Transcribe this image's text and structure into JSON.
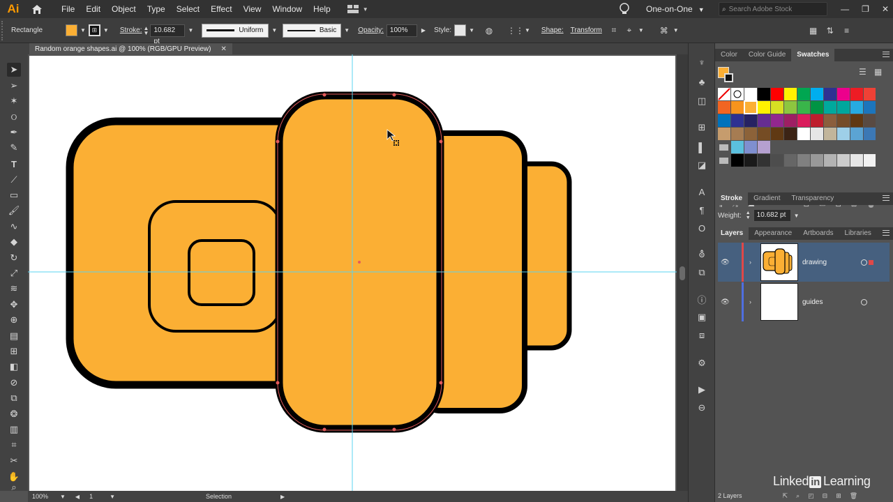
{
  "app": {
    "logo": "Ai"
  },
  "menu": [
    "File",
    "Edit",
    "Object",
    "Type",
    "Select",
    "Effect",
    "View",
    "Window",
    "Help"
  ],
  "workspace": "One-on-One",
  "search_placeholder": "Search Adobe Stock",
  "control_bar": {
    "selection_type": "Rectangle",
    "stroke_label": "Stroke:",
    "stroke_weight": "10.682 pt",
    "stroke_profile": "Uniform",
    "brush": "Basic",
    "opacity_label": "Opacity:",
    "opacity": "100%",
    "style_label": "Style:",
    "shape_label": "Shape:",
    "transform_label": "Transform"
  },
  "document_tab": {
    "title": "Random orange shapes.ai @ 100% (RGB/GPU Preview)"
  },
  "status_bar": {
    "zoom": "100%",
    "artboard": "1",
    "tool": "Selection"
  },
  "swatches_panel": {
    "tabs": [
      "Color",
      "Color Guide",
      "Swatches"
    ],
    "active_tab": "Swatches",
    "fill_color": "#fbaf34",
    "stroke_color": "#000000",
    "rows": [
      [
        "none",
        "reg",
        "#ffffff",
        "#000000",
        "#ff0000",
        "#fff200",
        "#00a651",
        "#00aeef",
        "#2e3192",
        "#ec008c",
        "#ed1c24",
        "#ef4136"
      ],
      [
        "#f26522",
        "#f7941d",
        "#fbaf34",
        "#fff200",
        "#d7df23",
        "#8dc63f",
        "#39b54a",
        "#009444",
        "#00a99d",
        "#00a79d",
        "#27aae1",
        "#1c75bc"
      ],
      [
        "#0072bc",
        "#2e3192",
        "#262262",
        "#662d91",
        "#92278f",
        "#9e1f63",
        "#da1c5c",
        "#be1e2d",
        "#8b5e3c",
        "#754c29",
        "#603813",
        "#594a42"
      ],
      [
        "#c69c6d",
        "#a67c52",
        "#8c6239",
        "#754c24",
        "#603913",
        "#3c2415",
        "#ffffff",
        "#e6e6e6",
        "#c2b59b",
        "#9ecfe8",
        "#5ba4d4",
        "#3c78b5"
      ],
      [
        "folder",
        "#5bc0de",
        "#7f8fd0",
        "#b5a0d0"
      ],
      [
        "folder",
        "#000000",
        "#1a1a1a",
        "#333333",
        "#4d4d4d",
        "#666666",
        "#808080",
        "#999999",
        "#b3b3b3",
        "#cccccc",
        "#e6e6e6",
        "#f2f2f2"
      ]
    ]
  },
  "stroke_panel": {
    "tabs": [
      "Stroke",
      "Gradient",
      "Transparency"
    ],
    "active_tab": "Stroke",
    "weight_label": "Weight:",
    "weight": "10.682 pt"
  },
  "layers_panel": {
    "tabs": [
      "Layers",
      "Appearance",
      "Artboards",
      "Libraries"
    ],
    "active_tab": "Layers",
    "layers": [
      {
        "name": "drawing",
        "color": "#e04848",
        "selected": true
      },
      {
        "name": "guides",
        "color": "#4f6fe0",
        "selected": false
      }
    ],
    "count": "2 Layers"
  },
  "watermark": {
    "brand": "Linked",
    "brand_box": "in",
    "suffix": "Learning"
  },
  "colors": {
    "shape_fill": "#fbaf34",
    "guide": "#59d3f0",
    "selection": "#e35a5a"
  }
}
